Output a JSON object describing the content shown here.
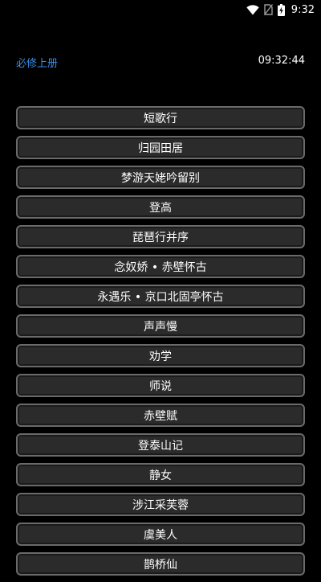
{
  "status_bar": {
    "time": "9:32",
    "icons": [
      "wifi-icon",
      "no-sim-icon",
      "battery-charging-icon"
    ]
  },
  "header": {
    "book_title": "必修上册",
    "clock": "09:32:44",
    "accent_color": "#3a8ee6"
  },
  "poems": [
    {
      "title": "短歌行"
    },
    {
      "title": "归园田居"
    },
    {
      "title": "梦游天姥吟留别"
    },
    {
      "title": "登高"
    },
    {
      "title": "琵琶行并序"
    },
    {
      "title": "念奴娇 • 赤壁怀古"
    },
    {
      "title": "永遇乐 • 京口北固亭怀古"
    },
    {
      "title": "声声慢"
    },
    {
      "title": "劝学"
    },
    {
      "title": "师说"
    },
    {
      "title": "赤壁赋"
    },
    {
      "title": "登泰山记"
    },
    {
      "title": "静女"
    },
    {
      "title": "涉江采芙蓉"
    },
    {
      "title": "虞美人"
    },
    {
      "title": "鹊桥仙"
    }
  ]
}
